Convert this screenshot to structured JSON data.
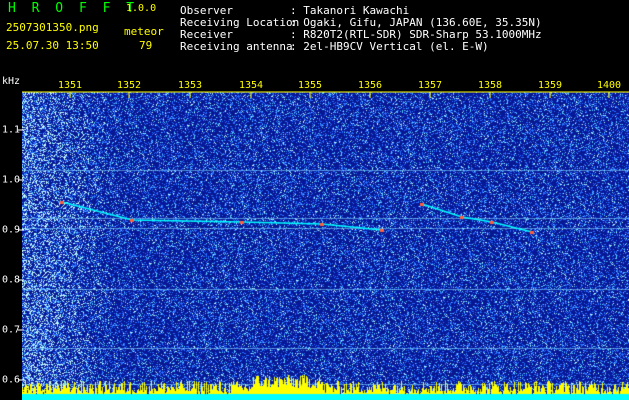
{
  "header": {
    "app_name": "H R O F F T",
    "version": "1.0.0",
    "file_name": "2507301350.png",
    "datetime": "25.07.30 13:50",
    "control_label": "meteor",
    "meteor_count": "79",
    "info": [
      {
        "label": "Observer",
        "value": ": Takanori Kawachi"
      },
      {
        "label": "Receiving Location",
        "value": ": Ogaki, Gifu, JAPAN (136.60E, 35.35N)"
      },
      {
        "label": "Receiver",
        "value": ": R820T2(RTL-SDR) SDR-Sharp 53.1000MHz"
      },
      {
        "label": "Receiving antenna",
        "value": ": 2el-HB9CV Vertical (el. E-W)"
      }
    ]
  },
  "axes": {
    "y_unit": "kHz",
    "x_ticks": [
      "1351",
      "1352",
      "1353",
      "1354",
      "1355",
      "1356",
      "1357",
      "1358",
      "1359",
      "1400"
    ],
    "y_ticks": [
      "1.1",
      "1.0",
      "0.9",
      "0.8",
      "0.7",
      "0.6"
    ]
  },
  "colors": {
    "background": "#000000",
    "spectrum_base": "#0a1f8c",
    "noise": "#3b7bff",
    "signal": "#00ffff",
    "meteor": "#ff6040",
    "header_yellow": "#ffff00",
    "header_green": "#00ff00",
    "axis_tick": "#ffff00"
  }
}
